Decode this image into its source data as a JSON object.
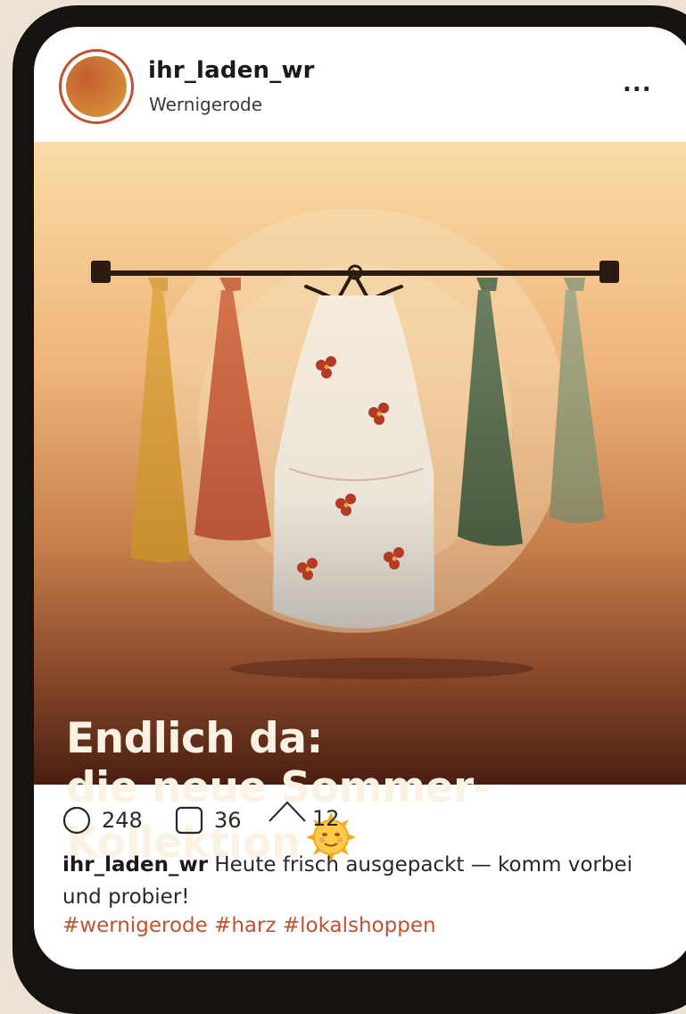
{
  "post": {
    "username": "ihr_laden_wr",
    "location": "Wernigerode",
    "more_label": "...",
    "headline_line1": "Endlich da:",
    "headline_line2": "die neue Sommer-",
    "headline_line3": "Kollektion",
    "headline_emoji": "sun-with-face-emoji",
    "likes": "248",
    "comments": "36",
    "shares": "12",
    "caption_user": "ihr_laden_wr",
    "caption_text": "Heute frisch ausgepackt — komm vorbei und probier!",
    "hashtags": "#wernigerode #harz #lokalshoppen"
  },
  "icons": {
    "like": "heart-circle-icon",
    "comment": "comment-square-icon",
    "share": "share-arrow-icon",
    "more": "more-options-icon"
  },
  "colors": {
    "accent": "#c0522f",
    "headline": "#fbf2e3",
    "image_top": "#f9d9a3",
    "image_bottom": "#4a1e12"
  }
}
